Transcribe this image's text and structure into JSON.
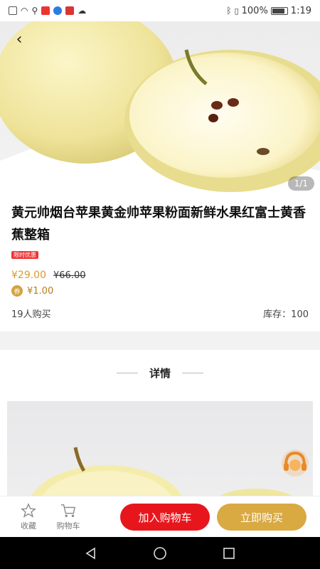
{
  "status_bar": {
    "battery": "100%",
    "time": "1:19"
  },
  "hero": {
    "pager": "1/1"
  },
  "product": {
    "title": "黄元帅烟台苹果黄金帅苹果粉面新鲜水果红富士黄香蕉整箱",
    "tag": "限时优惠",
    "price": "¥29.00",
    "original_price": "¥66.00",
    "coupon_badge": "券",
    "coupon_value": "¥1.00",
    "buyers": "19人购买",
    "stock": "库存：100"
  },
  "details": {
    "title": "详情"
  },
  "actions": {
    "favorite_label": "收藏",
    "cart_label": "购物车",
    "add_to_cart": "加入购物车",
    "buy_now": "立即购买"
  },
  "colors": {
    "accent_red": "#e7161d",
    "accent_gold": "#d9a942",
    "price_gold": "#d79b2b"
  },
  "icons": {
    "back": "back-arrow-icon",
    "favorite": "star-icon",
    "cart": "cart-icon",
    "service": "headset-icon",
    "nav_back": "nav-back-icon",
    "nav_home": "nav-home-icon",
    "nav_recent": "nav-recent-icon"
  }
}
